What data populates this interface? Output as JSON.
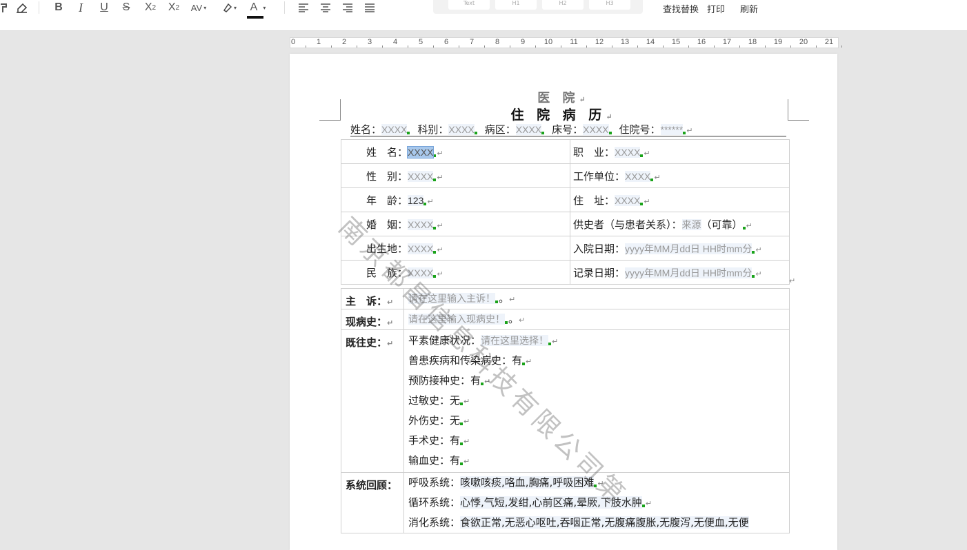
{
  "toolbar": {
    "style_cards": [
      "Text",
      "H1",
      "H2",
      "H3"
    ],
    "find_replace": "查找替换",
    "print": "打印",
    "refresh": "刷新",
    "font_color_bar": "#111111"
  },
  "ruler": {
    "numbers": [
      "0",
      "1",
      "2",
      "3",
      "4",
      "5",
      "6",
      "7",
      "8",
      "9",
      "10",
      "11",
      "12",
      "13",
      "14",
      "15",
      "16",
      "17",
      "18",
      "19",
      "20",
      "21"
    ]
  },
  "document": {
    "hospital": "医 院",
    "title": "住 院 病 历",
    "para_mark": "↵",
    "info_line": [
      {
        "label": "姓名：",
        "value": "XXXX"
      },
      {
        "label": "科别：",
        "value": "XXXX"
      },
      {
        "label": "病区：",
        "value": "XXXX"
      },
      {
        "label": "床号：",
        "value": "XXXX"
      },
      {
        "label": "住院号：",
        "value": "******"
      }
    ],
    "basic_rows": [
      {
        "left_label": "姓　名：",
        "left_value": "XXXX",
        "right_label": "职　业：",
        "right_value": "XXXX"
      },
      {
        "left_label": "性　别：",
        "left_value": "XXXX",
        "right_label": "工作单位：",
        "right_value": "XXXX"
      },
      {
        "left_label": "年　龄：",
        "left_value": "123",
        "right_label": "住　址：",
        "right_value": "XXXX"
      },
      {
        "left_label": "婚　姻：",
        "left_value": "XXXX",
        "right_label": "供史者（与患者关系）：",
        "right_value": "来源",
        "right_extra": "（可靠）"
      },
      {
        "left_label": "出生地：",
        "left_value": "XXXX",
        "right_label": "入院日期：",
        "right_value": "yyyy年MM月dd日 HH时mm分"
      },
      {
        "left_label": "民　族：",
        "left_value": "XXXX",
        "right_label": "记录日期：",
        "right_value": "yyyy年MM月dd日 HH时mm分"
      }
    ],
    "chief_complaint": {
      "label": "主　诉：",
      "placeholder": "请在这里输入主诉！",
      "suffix": "。"
    },
    "present_illness": {
      "label": "现病史：",
      "placeholder": "请在这里输入现病史！",
      "suffix": "。"
    },
    "past_history": {
      "label": "既往史：",
      "health_label": "平素健康状况：",
      "health_placeholder": "请在这里选择！",
      "items": [
        {
          "label": "曾患疾病和传染病史：",
          "value": "有"
        },
        {
          "label": "预防接种史：",
          "value": "有"
        },
        {
          "label": "过敏史：",
          "value": "无"
        },
        {
          "label": "外伤史：",
          "value": "无"
        },
        {
          "label": "手术史：",
          "value": "有"
        },
        {
          "label": "输血史：",
          "value": "有"
        }
      ]
    },
    "system_review": {
      "label": "系统回顾：",
      "items": [
        {
          "label": "呼吸系统：",
          "value": "咳嗽咳痰,咯血,胸痛,呼吸困难"
        },
        {
          "label": "循环系统：",
          "value": "心悸,气短,发绀,心前区痛,晕厥,下肢水肿"
        },
        {
          "label": "消化系统：",
          "value": "食欲正常,无恶心呕吐,吞咽正常,无腹痛腹胀,无腹泻,无便血,无便"
        }
      ]
    },
    "watermark": "南京都昌信息科技有限公司第"
  }
}
